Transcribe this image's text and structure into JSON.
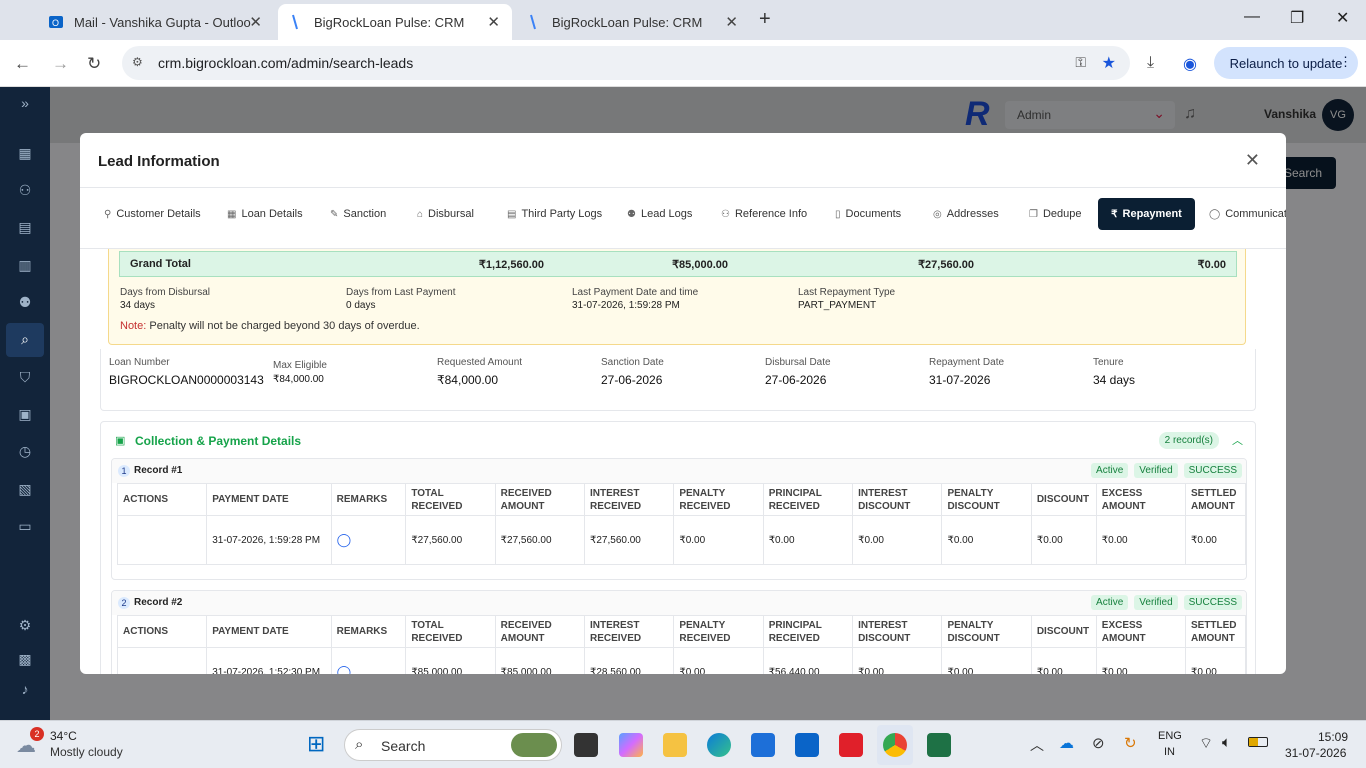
{
  "browser": {
    "tabs": [
      {
        "title": "Mail - Vanshika Gupta - Outloo",
        "active": false
      },
      {
        "title": "BigRockLoan Pulse: CRM",
        "active": true
      },
      {
        "title": "BigRockLoan Pulse: CRM",
        "active": false
      }
    ],
    "url": "crm.bigrockloan.com/admin/search-leads",
    "relaunch_label": "Relaunch to update"
  },
  "app": {
    "role": "Admin",
    "user": "Vanshika",
    "avatar": "VG",
    "search_label": "Search"
  },
  "modal": {
    "title": "Lead Information",
    "tabs": [
      {
        "label": "Customer Details",
        "icon": "user-icon"
      },
      {
        "label": "Loan Details",
        "icon": "calculator-icon"
      },
      {
        "label": "Sanction",
        "icon": "edit-icon"
      },
      {
        "label": "Disbursal",
        "icon": "bank-icon"
      },
      {
        "label": "Third Party Logs",
        "icon": "file-icon"
      },
      {
        "label": "Lead Logs",
        "icon": "users-icon"
      },
      {
        "label": "Reference Info",
        "icon": "user-plus-icon"
      },
      {
        "label": "Documents",
        "icon": "document-icon"
      },
      {
        "label": "Addresses",
        "icon": "map-pin-icon"
      },
      {
        "label": "Dedupe",
        "icon": "copy-icon"
      },
      {
        "label": "Repayment",
        "icon": "rupee-icon",
        "active": true
      },
      {
        "label": "Communicatio",
        "icon": "chat-icon"
      }
    ],
    "grand_total": {
      "label": "Grand Total",
      "values": [
        "₹1,12,560.00",
        "₹85,000.00",
        "₹27,560.00",
        "₹0.00"
      ]
    },
    "stats": [
      {
        "label": "Days from Disbursal",
        "value": "34 days"
      },
      {
        "label": "Days from Last Payment",
        "value": "0 days"
      },
      {
        "label": "Last Payment Date and time",
        "value": "31-07-2026, 1:59:28 PM"
      },
      {
        "label": "Last Repayment Type",
        "value": "PART_PAYMENT"
      }
    ],
    "note_prefix": "Note:",
    "note_text": "Penalty will not be charged beyond 30 days of overdue.",
    "summary": [
      {
        "label": "Loan Number",
        "value": "BIGROCKLOAN0000003143"
      },
      {
        "label": "Max Eligible",
        "value": "₹84,000.00"
      },
      {
        "label": "Requested Amount",
        "value": "₹84,000.00"
      },
      {
        "label": "Sanction Date",
        "value": "27-06-2026"
      },
      {
        "label": "Disbursal Date",
        "value": "27-06-2026"
      },
      {
        "label": "Repayment Date",
        "value": "31-07-2026"
      },
      {
        "label": "Tenure",
        "value": "34 days"
      }
    ],
    "collection": {
      "title": "Collection & Payment Details",
      "count_badge": "2 record(s)",
      "columns": [
        "ACTIONS",
        "PAYMENT DATE",
        "REMARKS",
        "TOTAL RECEIVED",
        "RECEIVED AMOUNT",
        "INTEREST RECEIVED",
        "PENALTY RECEIVED",
        "PRINCIPAL RECEIVED",
        "INTEREST DISCOUNT",
        "PENALTY DISCOUNT",
        "DISCOUNT",
        "EXCESS AMOUNT",
        "SETTLED AMOUNT"
      ],
      "records": [
        {
          "num": "1",
          "title": "Record #1",
          "badges": [
            "Active",
            "Verified",
            "SUCCESS"
          ],
          "row": [
            "",
            "31-07-2026, 1:59:28 PM",
            "",
            "₹27,560.00",
            "₹27,560.00",
            "₹27,560.00",
            "₹0.00",
            "₹0.00",
            "₹0.00",
            "₹0.00",
            "₹0.00",
            "₹0.00",
            "₹0.00"
          ]
        },
        {
          "num": "2",
          "title": "Record #2",
          "badges": [
            "Active",
            "Verified",
            "SUCCESS"
          ],
          "row": [
            "",
            "31-07-2026, 1:52:30 PM",
            "",
            "₹85,000.00",
            "₹85,000.00",
            "₹28,560.00",
            "₹0.00",
            "₹56,440.00",
            "₹0.00",
            "₹0.00",
            "₹0.00",
            "₹0.00",
            "₹0.00"
          ]
        }
      ]
    }
  },
  "taskbar": {
    "weather_temp": "34°C",
    "weather_desc": "Mostly cloudy",
    "weather_badge": "2",
    "search_placeholder": "Search",
    "lang_top": "ENG",
    "lang_bottom": "IN",
    "time": "15:09",
    "date": "31-07-2026"
  },
  "colors": {
    "accent": "#0b1f33",
    "success": "#16a34a",
    "note": "#c53030"
  }
}
